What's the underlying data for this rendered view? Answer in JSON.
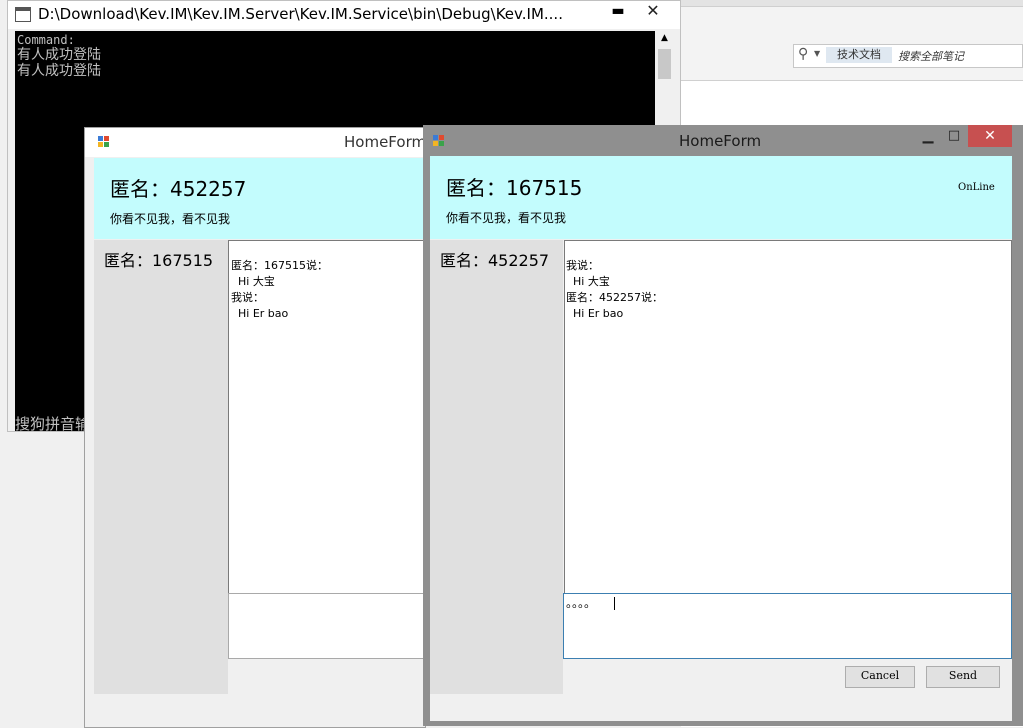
{
  "background_app": {
    "search_scope": "技术文档",
    "search_placeholder": "搜索全部笔记"
  },
  "console": {
    "title": "D:\\Download\\Kev.IM\\Kev.IM.Server\\Kev.IM.Service\\bin\\Debug\\Kev.IM....",
    "lines": [
      "Command:",
      "有人成功登陆",
      "有人成功登陆"
    ],
    "ime_text": "搜狗拼音输"
  },
  "form_back": {
    "title": "HomeForm",
    "user_name": "匿名：452257",
    "signature": "你看不见我，看不见我",
    "contact_name": "匿名：167515",
    "chat_lines": [
      "匿名：167515说：",
      "  Hi 大宝",
      "我说：",
      "  Hi Er bao"
    ]
  },
  "form_front": {
    "title": "HomeForm",
    "user_name": "匿名：167515",
    "signature": "你看不见我，看不见我",
    "status": "OnLine",
    "contact_name": "匿名：452257",
    "chat_lines": [
      "我说：",
      "  Hi 大宝",
      "匿名：452257说：",
      "  Hi Er bao"
    ],
    "input_text": "。。。。",
    "cancel_label": "Cancel",
    "send_label": "Send",
    "minimize_glyph": "▁",
    "maximize_glyph": "□",
    "close_glyph": "✕"
  },
  "icons": {
    "console_app": "console-window-icon",
    "form_app": "windows-forms-icon",
    "search": "search-icon"
  }
}
